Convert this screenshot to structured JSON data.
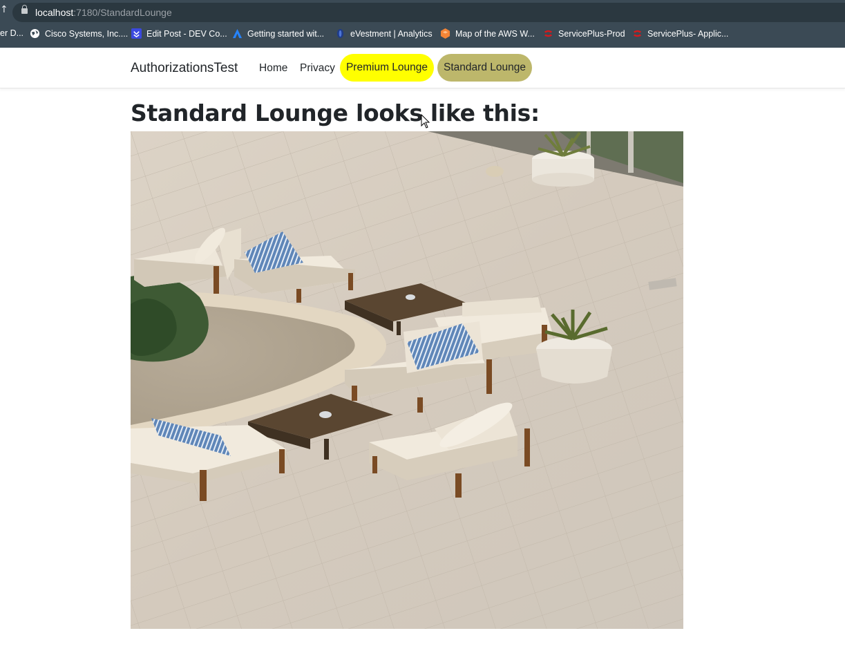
{
  "browser": {
    "url_host": "localhost",
    "url_path": ":7180/StandardLounge",
    "bookmarks": [
      {
        "label": "er D...",
        "icon": "none"
      },
      {
        "label": "Cisco Systems, Inc....",
        "icon": "globe-icon"
      },
      {
        "label": "Edit Post - DEV Co...",
        "icon": "dev-icon"
      },
      {
        "label": "Getting started wit...",
        "icon": "atlassian-icon"
      },
      {
        "label": "eVestment | Analytics",
        "icon": "evestment-icon"
      },
      {
        "label": "Map of the AWS W...",
        "icon": "aws-icon"
      },
      {
        "label": "ServicePlus-Prod",
        "icon": "serviceplus-icon"
      },
      {
        "label": "ServicePlus- Applic...",
        "icon": "serviceplus-icon"
      }
    ]
  },
  "nav": {
    "brand": "AuthorizationsTest",
    "home": "Home",
    "privacy": "Privacy",
    "premium": "Premium Lounge",
    "standard": "Standard Lounge",
    "premium_color": "#ffff00",
    "standard_color": "#bdb76b"
  },
  "main": {
    "heading": "Standard Lounge looks like this:",
    "image_subject": "outdoor patio with lounge chairs"
  }
}
